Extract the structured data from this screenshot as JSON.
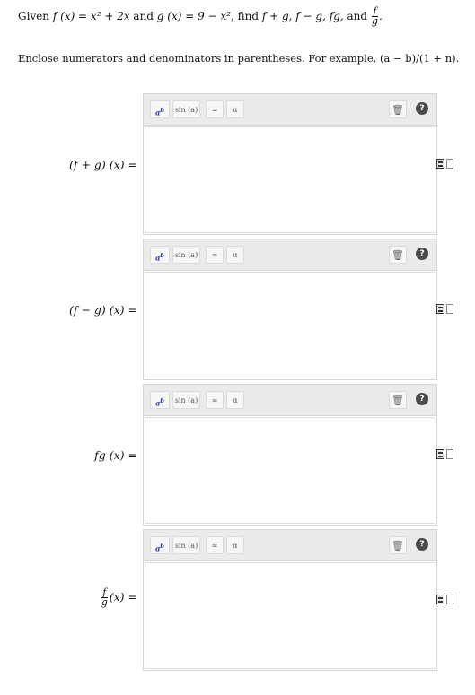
{
  "prompt": {
    "lead": "Given ",
    "f_def": "f (x) = x² + 2x",
    "and1": " and ",
    "g_def": "g (x) = 9 − x²",
    "find": ", find ",
    "targets": "f + g, f − g, fg,",
    "and2": " and ",
    "frac_num": "f",
    "frac_den": "g",
    "end": "."
  },
  "instructions": "Enclose numerators and denominators in parentheses. For example, (a − b)/(1 + n).",
  "toolbar": {
    "power_base": "a",
    "power_exp": "b",
    "sin_label": "sin (a)",
    "infinity_label": "∞",
    "alpha_label": "α",
    "trash_glyph": "🗑",
    "help_glyph": "?"
  },
  "questions": [
    {
      "label": "(f + g) (x) ="
    },
    {
      "label": "(f − g) (x) ="
    },
    {
      "label": "fg (x) ="
    },
    {
      "label_num": "f",
      "label_den": "g",
      "label_tail": "(x) ="
    }
  ]
}
